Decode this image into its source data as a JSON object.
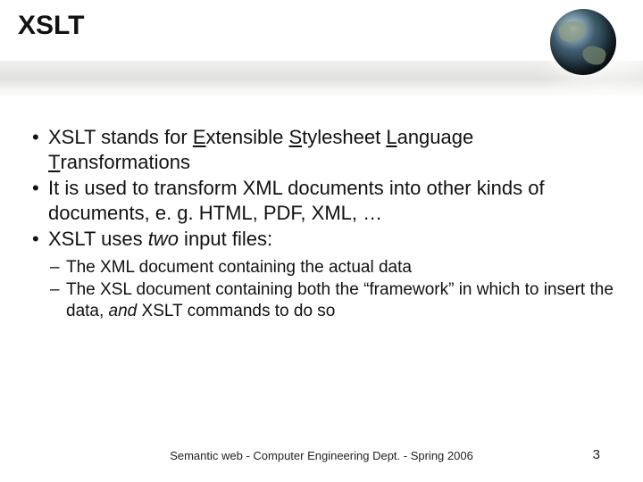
{
  "title": "XSLT",
  "bullets": [
    {
      "parts": [
        {
          "t": "XSLT stands for "
        },
        {
          "t": "E",
          "u": true
        },
        {
          "t": "xtensible "
        },
        {
          "t": "S",
          "u": true
        },
        {
          "t": "tylesheet "
        },
        {
          "t": "L",
          "u": true
        },
        {
          "t": "anguage "
        },
        {
          "t": "T",
          "u": true
        },
        {
          "t": "ransformations"
        }
      ]
    },
    {
      "parts": [
        {
          "t": "It is used to transform XML documents into other kinds of documents, e. g. HTML, PDF, XML, …"
        }
      ]
    },
    {
      "parts": [
        {
          "t": "XSLT uses "
        },
        {
          "t": "two",
          "i": true
        },
        {
          "t": " input files:"
        }
      ],
      "sub": [
        {
          "parts": [
            {
              "t": "The XML document containing the actual data"
            }
          ]
        },
        {
          "parts": [
            {
              "t": "The XSL document containing both the “framework” in which to insert the data, "
            },
            {
              "t": "and",
              "i": true
            },
            {
              "t": " XSLT commands to do so"
            }
          ]
        }
      ]
    }
  ],
  "footer": "Semantic web - Computer Engineering Dept. - Spring 2006",
  "page_number": "3"
}
